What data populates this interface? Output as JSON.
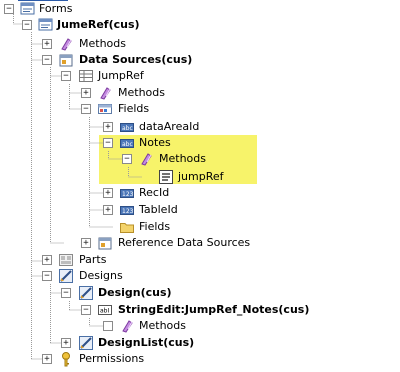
{
  "tree": {
    "forms": "Forms",
    "jumeref": "JumeRef(cus)",
    "methods_form": "Methods",
    "datasources": "Data Sources(cus)",
    "jumpref": "JumpRef",
    "methods_ds": "Methods",
    "fields": "Fields",
    "dataareaid": "dataAreaId",
    "notes": "Notes",
    "methods_notes": "Methods",
    "jumpref_method": "jumpRef",
    "recid": "RecId",
    "tableid": "TableId",
    "fields_group": "Fields",
    "refdatasources": "Reference Data Sources",
    "parts": "Parts",
    "designs": "Designs",
    "design": "Design(cus)",
    "stringedit": "StringEdit:JumpRef_Notes(cus)",
    "methods_stringedit": "Methods",
    "designlist": "DesignList(cus)",
    "permissions": "Permissions"
  },
  "colors": {
    "highlight": "#f7f36a",
    "guide_line": "#9a9a9a"
  },
  "icons": {
    "forms": "forms-icon",
    "form": "form-icon",
    "methods": "methods-icon",
    "datasources": "datasources-icon",
    "table": "table-icon",
    "fields": "fields-icon",
    "field": "field-icon",
    "method": "method-icon",
    "folder": "folder-icon",
    "parts": "parts-icon",
    "designs": "designs-icon",
    "design": "design-icon",
    "stringedit": "stringedit-icon",
    "permissions": "permissions-icon"
  }
}
